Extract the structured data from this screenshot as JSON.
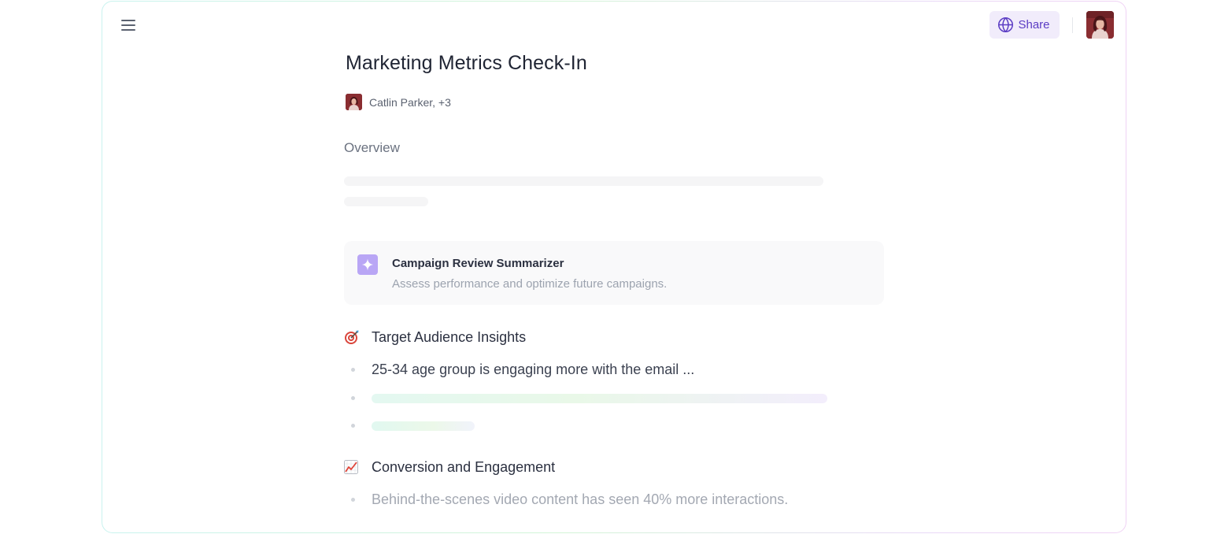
{
  "topbar": {
    "share_label": "Share",
    "icons": [
      "menu-icon",
      "globe-icon"
    ]
  },
  "document": {
    "title": "Marketing Metrics Check-In",
    "authors": "Catlin Parker, +3",
    "overview_label": "Overview"
  },
  "summarizer_card": {
    "title": "Campaign Review Summarizer",
    "description": "Assess performance and optimize future campaigns.",
    "icon": "sparkle-icon"
  },
  "sections": [
    {
      "emoji": "🎯",
      "icon": "target-icon",
      "title": "Target Audience Insights",
      "items": [
        "25-34 age group is engaging more with the email ..."
      ]
    },
    {
      "emoji": "📈",
      "icon": "chart-increasing-icon",
      "title": "Conversion and Engagement",
      "items": [
        "Behind-the-scenes video content has seen 40% more interactions."
      ]
    }
  ],
  "colors": {
    "accent": "#5b3cc4",
    "share_bg": "#f1ecfb",
    "sparkle_bg": "#b9a6f5",
    "title_text": "#1f2433",
    "muted_text": "#9ca3af"
  }
}
